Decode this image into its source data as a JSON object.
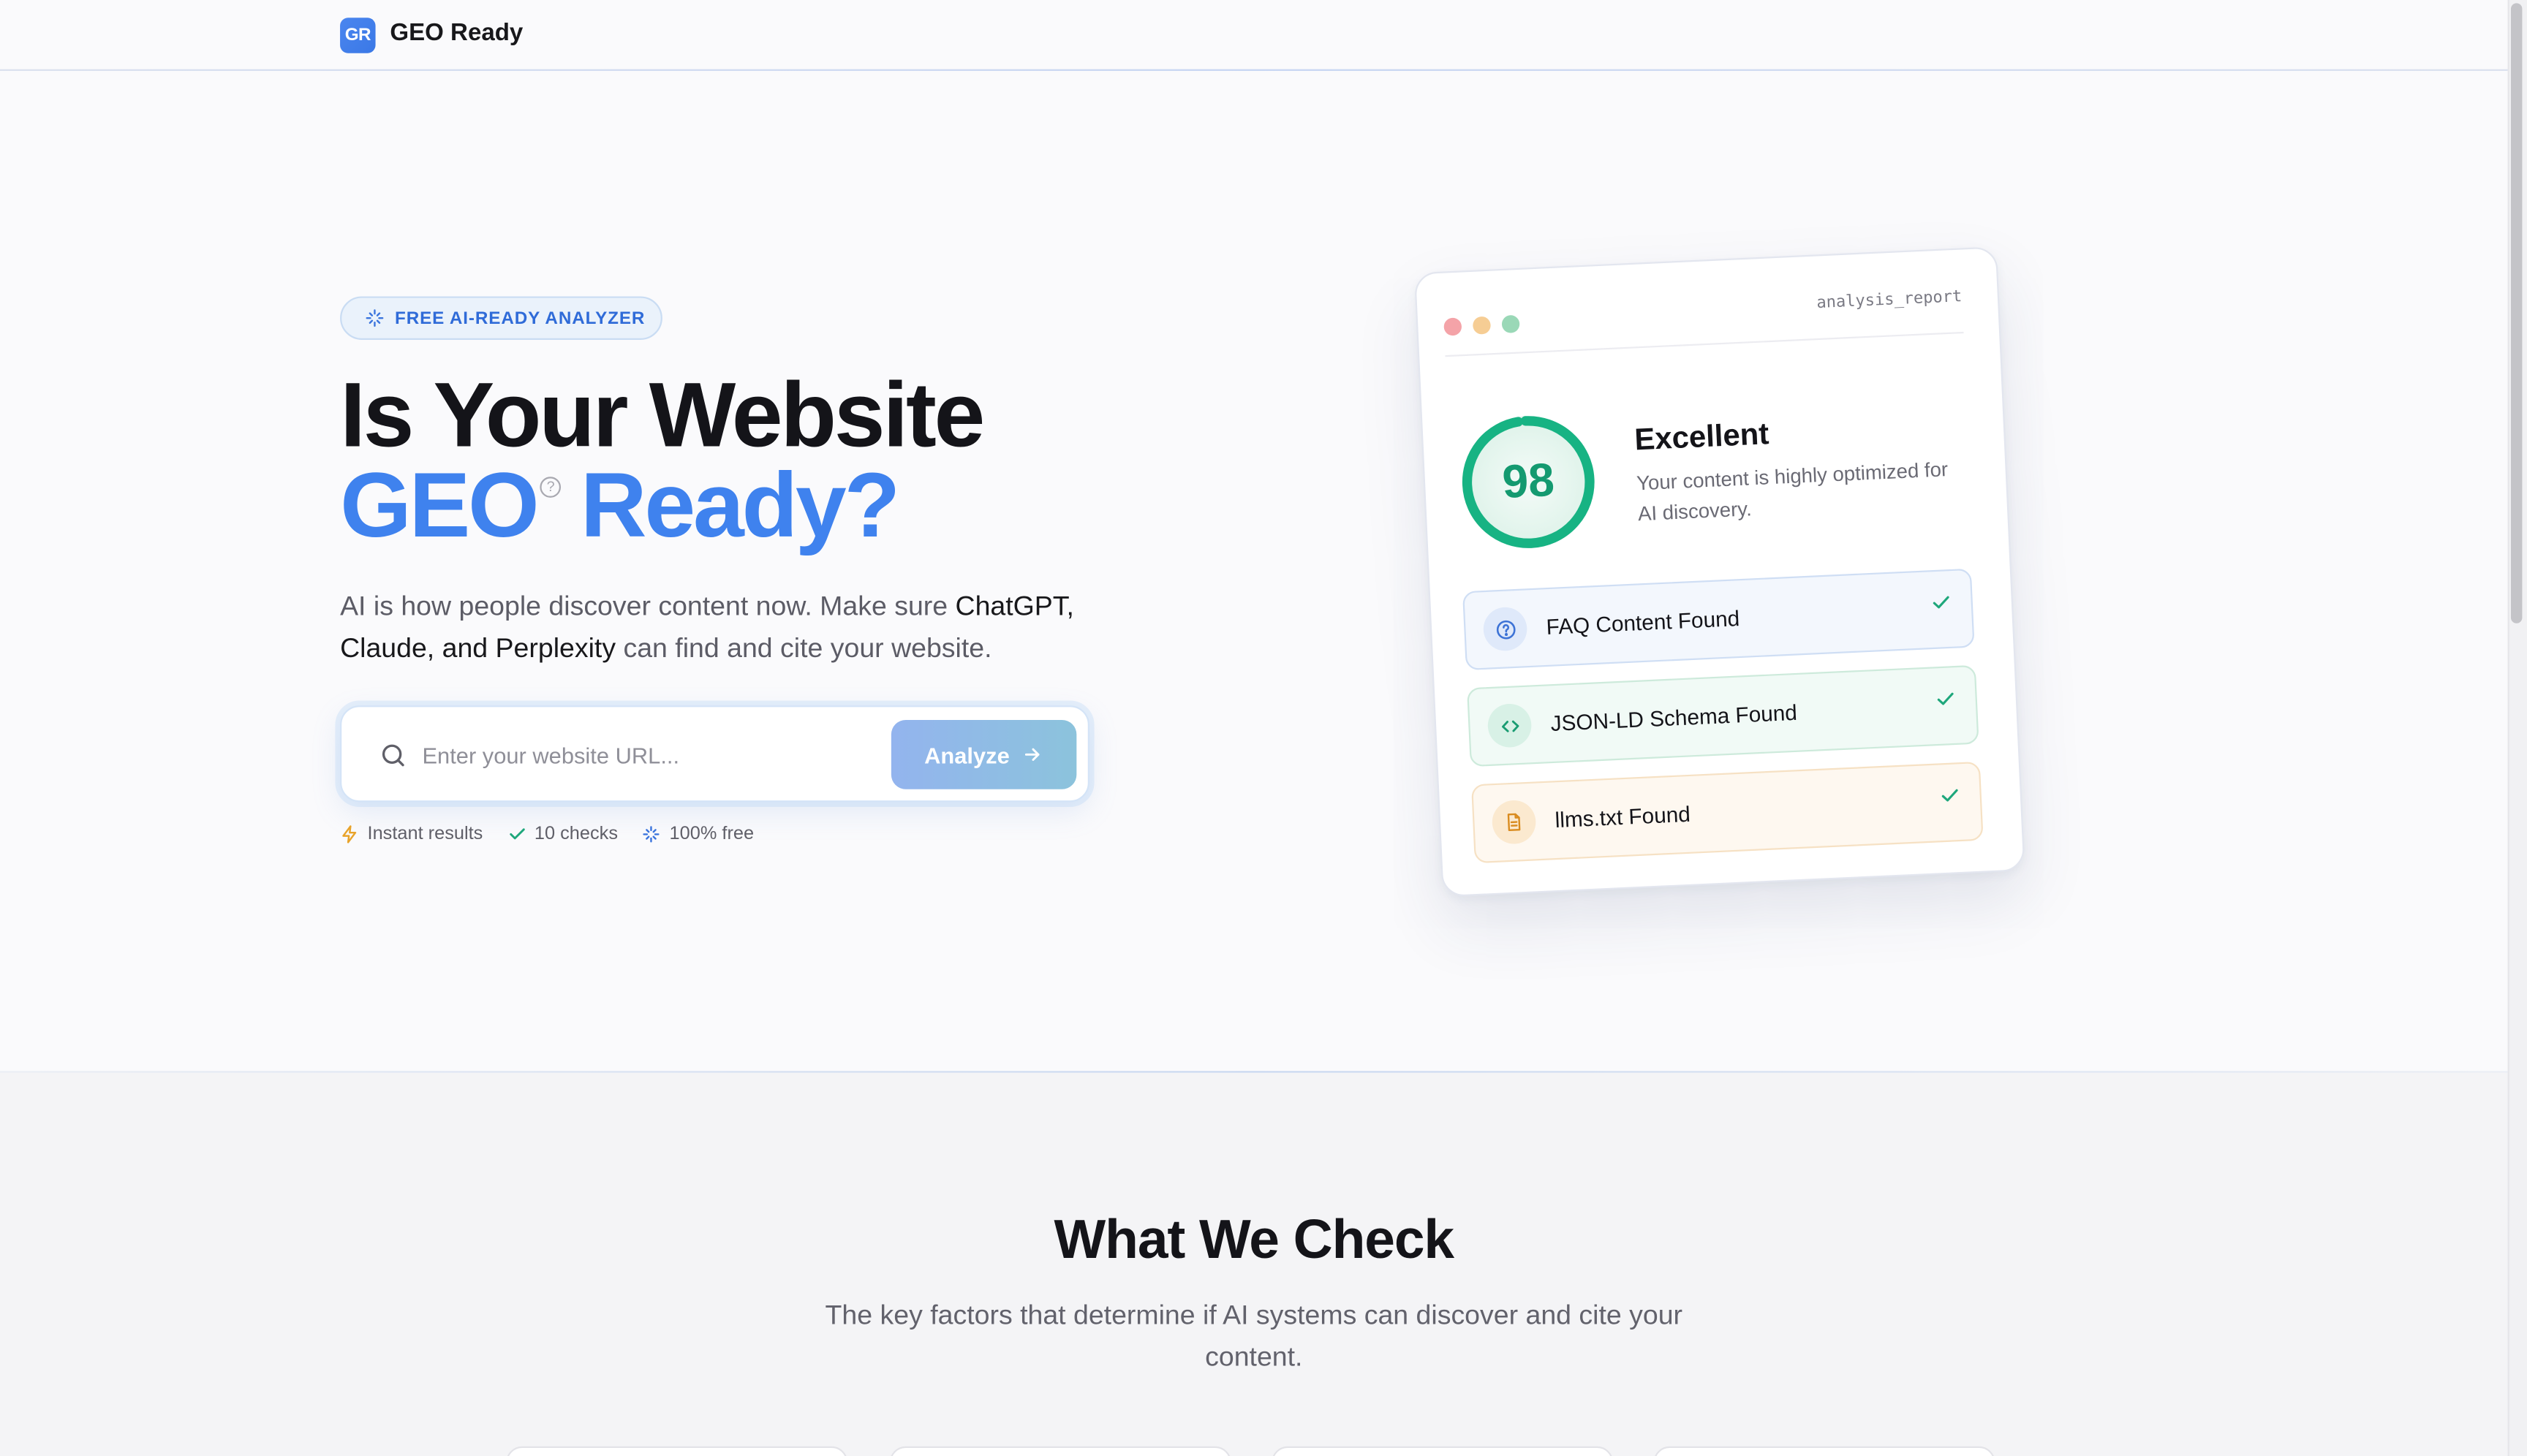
{
  "app": {
    "logo_badge": "GR",
    "name": "GEO Ready"
  },
  "hero": {
    "pill_label": "FREE AI-READY ANALYZER",
    "title_line1": "Is Your Website",
    "title_geo": "GEO",
    "title_reg": "?",
    "title_ready": "Ready?",
    "desc_part1": "AI is how people discover content now. Make sure ",
    "desc_strong1": "ChatGPT, Claude, and Perplexity",
    "desc_part2": " can find and cite your website."
  },
  "search": {
    "placeholder": "Enter your website URL...",
    "value": "",
    "button_label": "Analyze"
  },
  "features": [
    {
      "label": "Instant results",
      "icon": "lightning-icon"
    },
    {
      "label": "10 checks",
      "icon": "check-icon"
    },
    {
      "label": "100% free",
      "icon": "sparkle-icon"
    }
  ],
  "report_card": {
    "tag": "analysis_report",
    "score": "98",
    "score_fraction": 0.98,
    "grade": "Excellent",
    "grade_desc": "Your content is highly optimized for AI discovery.",
    "checks": [
      {
        "label": "FAQ Content Found",
        "icon": "question-icon",
        "status": "passed"
      },
      {
        "label": "JSON-LD Schema Found",
        "icon": "code-icon",
        "status": "passed"
      },
      {
        "label": "llms.txt Found",
        "icon": "document-icon",
        "status": "passed"
      }
    ]
  },
  "what_we_check": {
    "title": "What We Check",
    "subtitle": "The key factors that determine if AI systems can discover and cite your content."
  },
  "colors": {
    "accent": "#3f82ee",
    "success": "#16a37a",
    "dot_red": "#f4a3a8",
    "dot_yellow": "#f6cd94",
    "dot_green": "#9ad8b7"
  }
}
